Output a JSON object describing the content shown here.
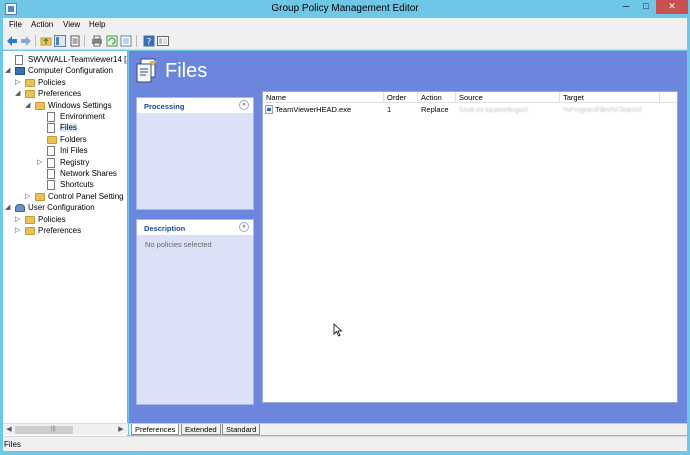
{
  "window": {
    "title": "Group Policy Management Editor"
  },
  "titlebar_buttons": {
    "minimize": "─",
    "maximize": "□",
    "close": "✕"
  },
  "menu": [
    "File",
    "Action",
    "View",
    "Help"
  ],
  "toolbar_icons": [
    "back-arrow-icon",
    "forward-arrow-icon",
    "up-folder-icon",
    "show-tree-icon",
    "properties-icon",
    "print-icon",
    "refresh-icon",
    "export-icon",
    "help-icon",
    "console-tree-icon"
  ],
  "tree": [
    {
      "label": "SWVWALL-Teamviewer14 [ATK",
      "toggle": "",
      "icon": "doc",
      "selected": false
    },
    {
      "label": "Computer Configuration",
      "toggle": "◢",
      "icon": "pc",
      "selected": false
    },
    {
      "label": "Policies",
      "toggle": "▷",
      "icon": "folder",
      "selected": false
    },
    {
      "label": "Preferences",
      "toggle": "◢",
      "icon": "folder",
      "selected": false
    },
    {
      "label": "Windows Settings",
      "toggle": "◢",
      "icon": "folder",
      "selected": false
    },
    {
      "label": "Environment",
      "toggle": "",
      "icon": "doc",
      "selected": false
    },
    {
      "label": "Files",
      "toggle": "",
      "icon": "doc",
      "selected": true
    },
    {
      "label": "Folders",
      "toggle": "",
      "icon": "folder",
      "selected": false
    },
    {
      "label": "Ini Files",
      "toggle": "",
      "icon": "doc",
      "selected": false
    },
    {
      "label": "Registry",
      "toggle": "▷",
      "icon": "doc",
      "selected": false
    },
    {
      "label": "Network Shares",
      "toggle": "",
      "icon": "doc",
      "selected": false
    },
    {
      "label": "Shortcuts",
      "toggle": "",
      "icon": "doc",
      "selected": false
    },
    {
      "label": "Control Panel Setting",
      "toggle": "▷",
      "icon": "folder",
      "selected": false
    },
    {
      "label": "User Configuration",
      "toggle": "◢",
      "icon": "user",
      "selected": false
    },
    {
      "label": "Policies",
      "toggle": "▷",
      "icon": "folder",
      "selected": false
    },
    {
      "label": "Preferences",
      "toggle": "▷",
      "icon": "folder",
      "selected": false
    }
  ],
  "main": {
    "title": "Files",
    "processing": {
      "header": "Processing",
      "collapse": "«"
    },
    "description": {
      "header": "Description",
      "collapse": "«",
      "text": "No policies selected"
    },
    "table": {
      "columns": [
        "Name",
        "Order",
        "Action",
        "Source",
        "Target"
      ],
      "rows": [
        {
          "name": "TeamViewerHEAD.exe",
          "order": "1",
          "action": "Replace",
          "source": "\\\\swk.ex.loca\\netlogon\\",
          "target": "%ProgramFiles%\\TeamVi"
        }
      ]
    }
  },
  "tabs": [
    "Preferences",
    "Extended",
    "Standard"
  ],
  "active_tab": "Preferences",
  "status": {
    "text": "Files"
  },
  "scroll": {
    "left": "◀",
    "right": "▶",
    "grip": "|||"
  },
  "colors": {
    "titlebar": "#6fc7e8",
    "pane": "#6b86dc",
    "panel": "#dbe1f7",
    "panel_header_text": "#1b4b9a",
    "close": "#c75050"
  }
}
